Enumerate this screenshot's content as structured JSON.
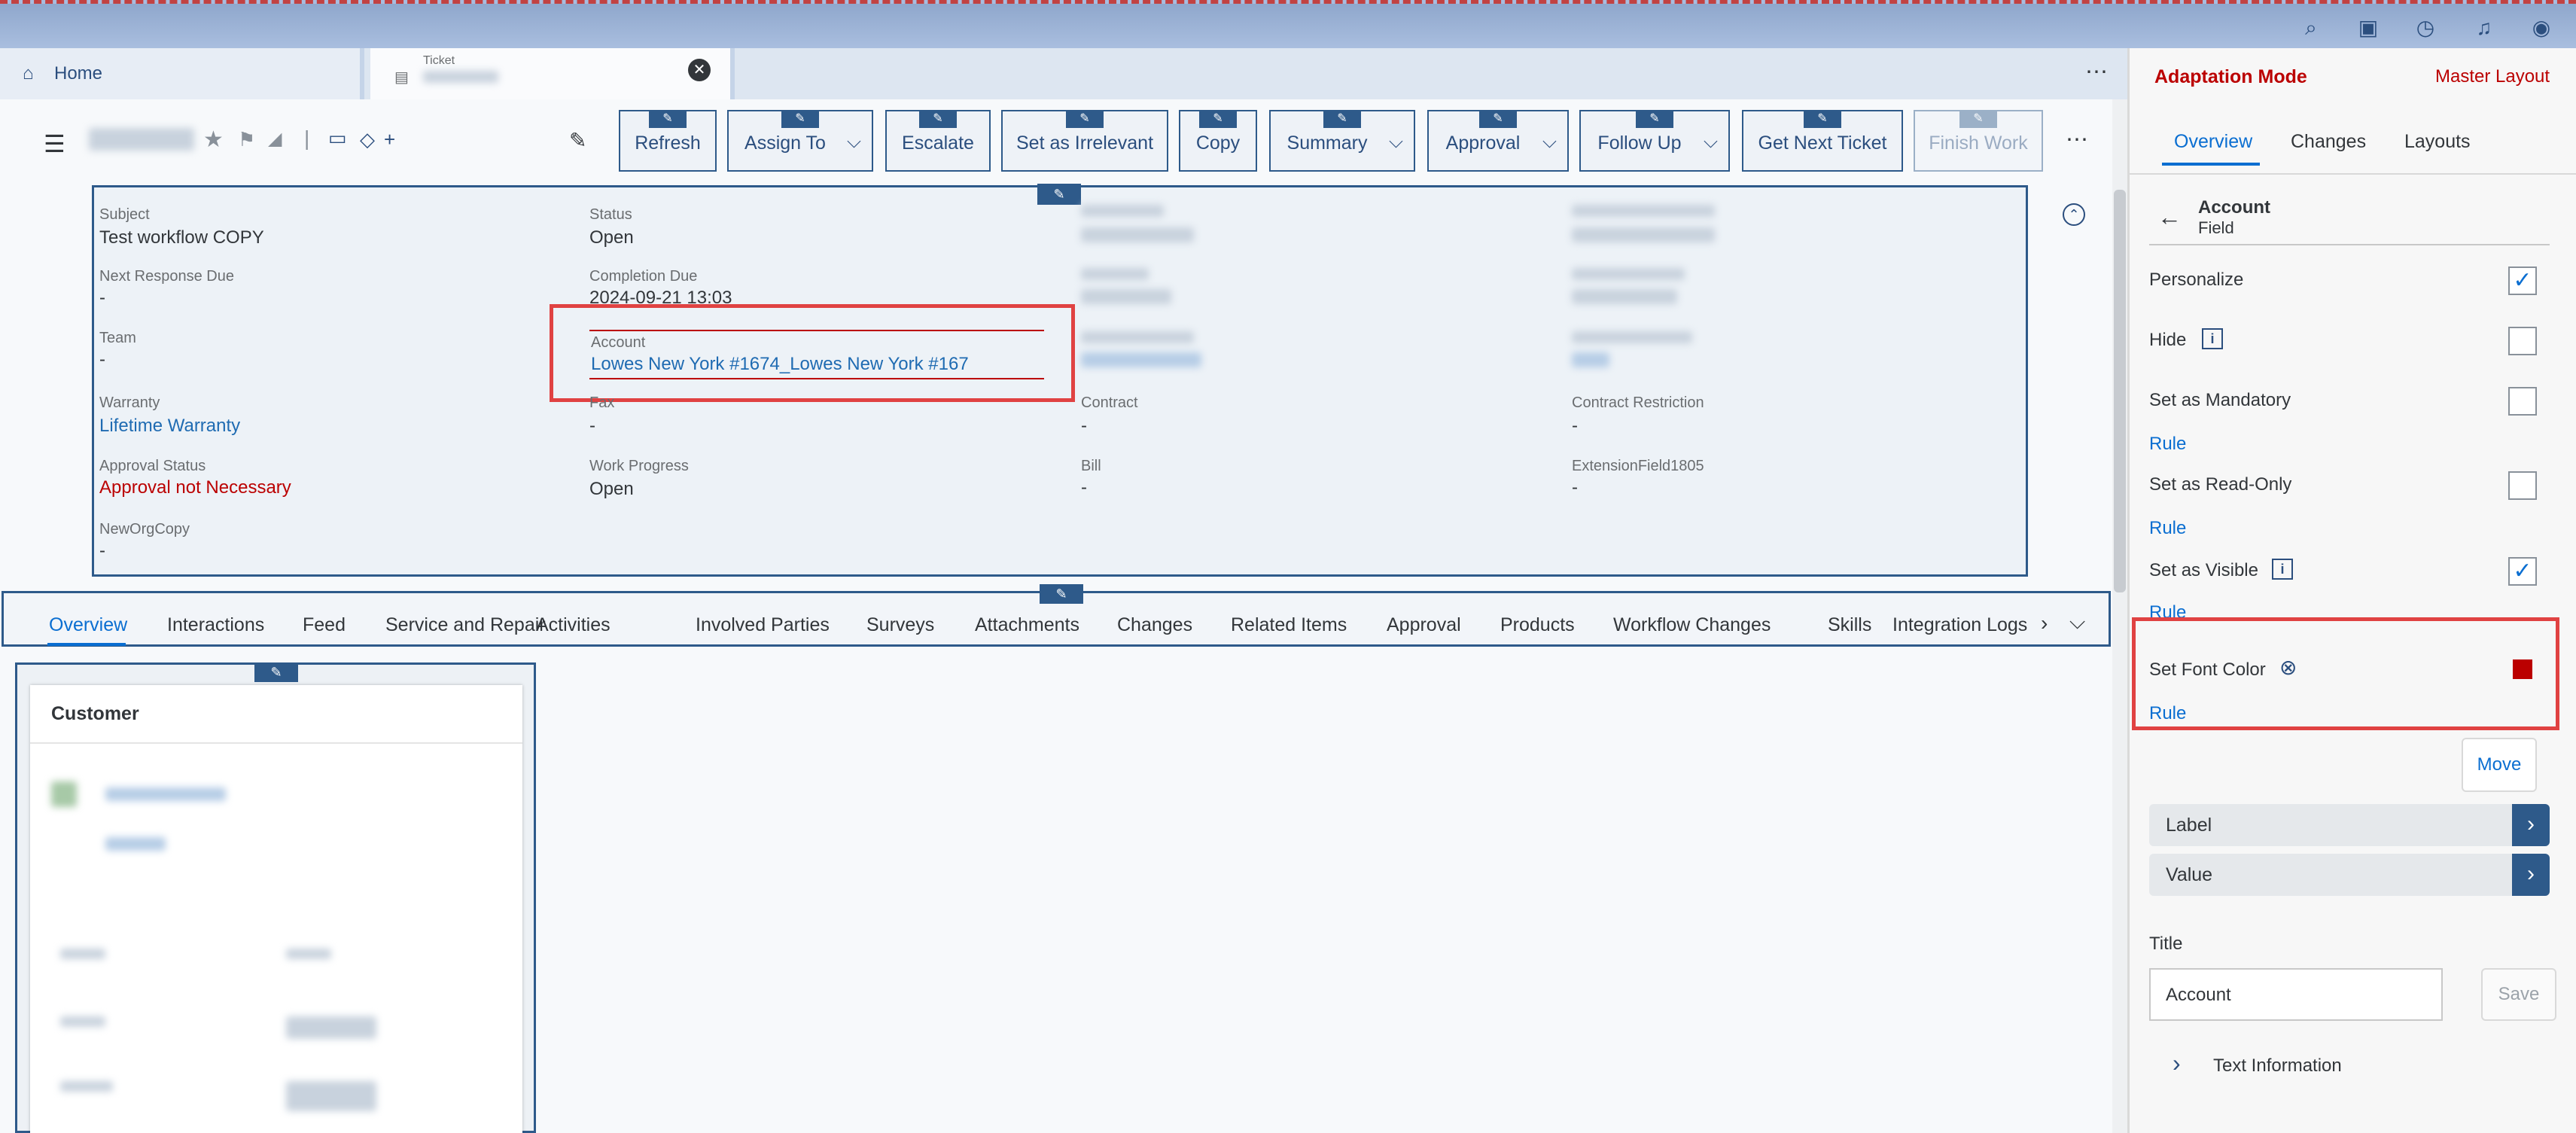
{
  "shell": {
    "icons": [
      "search-icon",
      "feedback-icon",
      "clock-icon",
      "bell-icon",
      "user-icon"
    ]
  },
  "tabs": {
    "home_label": "Home",
    "ticket_label": "Ticket",
    "more_icon": "more-icon"
  },
  "toolbar": {
    "buttons": [
      {
        "label": "Refresh",
        "dropdown": false
      },
      {
        "label": "Assign To",
        "dropdown": true
      },
      {
        "label": "Escalate",
        "dropdown": false
      },
      {
        "label": "Set as Irrelevant",
        "dropdown": false
      },
      {
        "label": "Copy",
        "dropdown": false
      },
      {
        "label": "Summary",
        "dropdown": true
      },
      {
        "label": "Approval",
        "dropdown": true
      },
      {
        "label": "Follow Up",
        "dropdown": true
      },
      {
        "label": "Get Next Ticket",
        "dropdown": false
      },
      {
        "label": "Finish Work",
        "dropdown": false,
        "disabled": true
      }
    ],
    "plus": "+"
  },
  "header": {
    "subject_label": "Subject",
    "subject_value": "Test workflow COPY",
    "status_label": "Status",
    "status_value": "Open",
    "next_response_label": "Next Response Due",
    "next_response_value": "-",
    "completion_label": "Completion Due",
    "completion_value": "2024-09-21 13:03",
    "team_label": "Team",
    "team_value": "-",
    "account_label": "Account",
    "account_value": "Lowes New York #1674_Lowes New York #167",
    "warranty_label": "Warranty",
    "warranty_value": "Lifetime Warranty",
    "fax_label": "Fax",
    "fax_value": "-",
    "contract_label": "Contract",
    "contract_value": "-",
    "contract_restriction_label": "Contract Restriction",
    "contract_restriction_value": "-",
    "approval_status_label": "Approval Status",
    "approval_status_value": "Approval not Necessary",
    "work_progress_label": "Work Progress",
    "work_progress_value": "Open",
    "bill_label": "Bill",
    "bill_value": "-",
    "ext_label": "ExtensionField1805",
    "ext_value": "-",
    "neworg_label": "NewOrgCopy",
    "neworg_value": "-"
  },
  "detail_tabs": [
    "Overview",
    "Interactions",
    "Feed",
    "Service and Repair",
    "Activities",
    "Involved Parties",
    "Surveys",
    "Attachments",
    "Changes",
    "Related Items",
    "Approval",
    "Products",
    "Workflow Changes",
    "Skills",
    "Integration Logs"
  ],
  "customer_card": {
    "title": "Customer"
  },
  "panel": {
    "title": "Adaptation Mode",
    "master_layout": "Master Layout",
    "tabs": [
      "Overview",
      "Changes",
      "Layouts"
    ],
    "field_title": "Account",
    "field_subtitle": "Field",
    "personalize": "Personalize",
    "hide": "Hide",
    "set_mandatory": "Set as Mandatory",
    "rule": "Rule",
    "set_readonly": "Set as Read-Only",
    "set_visible": "Set as Visible",
    "set_font_color": "Set Font Color",
    "font_color": "#bb0000",
    "move": "Move",
    "label": "Label",
    "value": "Value",
    "title_label": "Title",
    "title_value": "Account",
    "save": "Save",
    "text_information": "Text Information"
  }
}
